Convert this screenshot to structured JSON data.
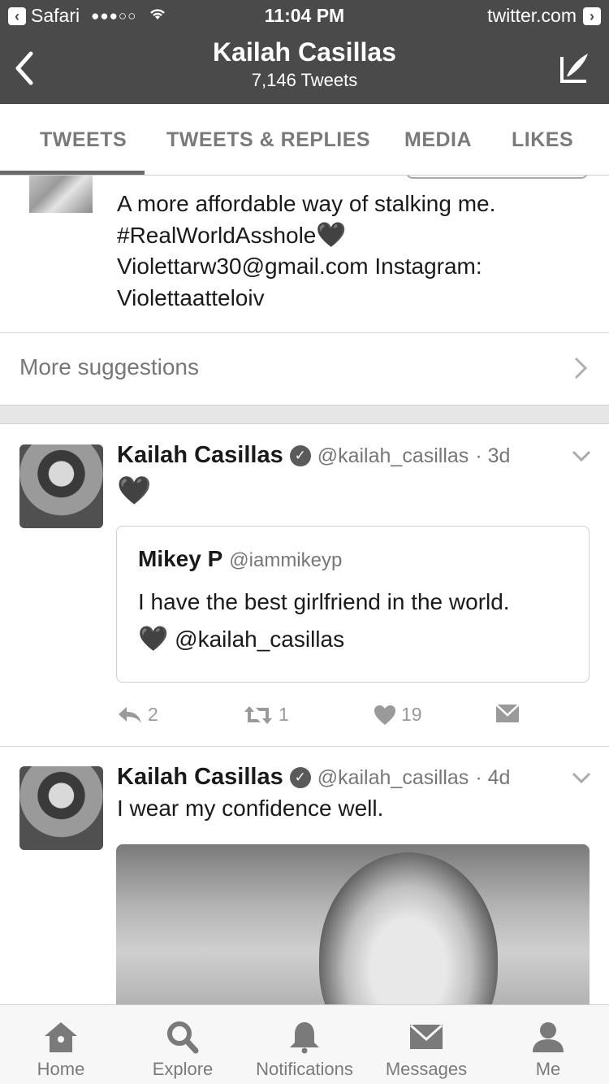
{
  "status_bar": {
    "carrier": "Safari",
    "signal": "●●●○○",
    "time": "11:04 PM",
    "site": "twitter.com"
  },
  "nav": {
    "title": "Kailah Casillas",
    "subtitle": "7,146 Tweets",
    "back_icon": "chevron-left-icon",
    "compose_icon": "compose-icon"
  },
  "tabs": [
    {
      "label": "TWEETS",
      "selected": true
    },
    {
      "label": "TWEETS & REPLIES",
      "selected": false
    },
    {
      "label": "MEDIA",
      "selected": false
    },
    {
      "label": "LIKES",
      "selected": false
    }
  ],
  "suggestion": {
    "bio_line1": "A more affordable way of stalking me.",
    "bio_line2": "#RealWorldAsshole",
    "bio_emoji": "🖤",
    "bio_line3": "Violettarw30@gmail.com Instagram:",
    "bio_line4": "Violettaatteloiv"
  },
  "more_suggestions": "More suggestions",
  "tweets": [
    {
      "name": "Kailah Casillas",
      "handle": "@kailah_casillas",
      "time": "· 3d",
      "text": "🖤",
      "quote": {
        "name": "Mikey P",
        "handle": "@iammikeyp",
        "line1": "I have the best girlfriend in the world.",
        "line2_emoji": "🖤",
        "line2": "@kailah_casillas"
      },
      "replies": "2",
      "retweets": "1",
      "likes": "19"
    },
    {
      "name": "Kailah Casillas",
      "handle": "@kailah_casillas",
      "time": "· 4d",
      "text": "I wear my confidence well."
    }
  ],
  "tabbar": [
    {
      "label": "Home",
      "icon": "home-icon"
    },
    {
      "label": "Explore",
      "icon": "search-icon"
    },
    {
      "label": "Notifications",
      "icon": "bell-icon"
    },
    {
      "label": "Messages",
      "icon": "envelope-icon"
    },
    {
      "label": "Me",
      "icon": "person-icon"
    }
  ]
}
